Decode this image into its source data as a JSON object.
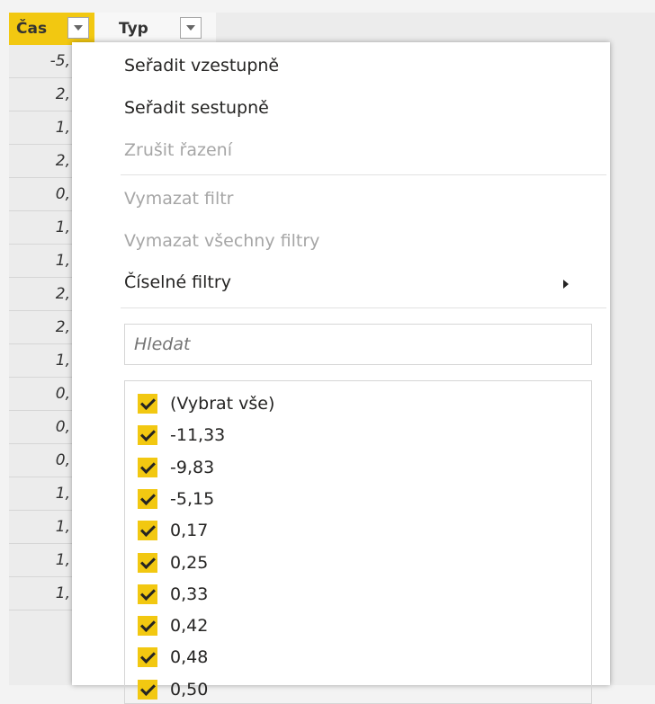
{
  "columns": {
    "cas": "Čas",
    "typ": "Typ"
  },
  "grid_values": [
    "-5,",
    "2,",
    "1,",
    "2,",
    "0,",
    "1,",
    "1,",
    "2,",
    "2,",
    "1,",
    "0,",
    "0,",
    "0,",
    "1,",
    "1,",
    "1,",
    "1,"
  ],
  "menu": {
    "sort_asc": "Seřadit vzestupně",
    "sort_desc": "Seřadit sestupně",
    "clear_sort": "Zrušit řazení",
    "clear_filter": "Vymazat filtr",
    "clear_all_filters": "Vymazat všechny filtry",
    "numeric_filters": "Číselné filtry"
  },
  "search": {
    "placeholder": "Hledat"
  },
  "filter_items": [
    "(Vybrat vše)",
    "-11,33",
    "-9,83",
    "-5,15",
    "0,17",
    "0,25",
    "0,33",
    "0,42",
    "0,48",
    "0,50"
  ],
  "colors": {
    "accent": "#f2c811"
  }
}
